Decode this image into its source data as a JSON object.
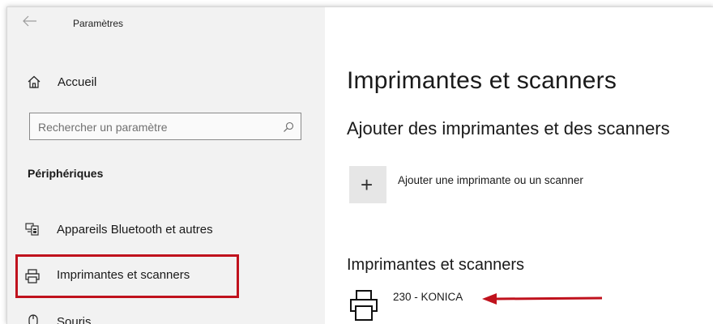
{
  "window": {
    "title": "Paramètres"
  },
  "sidebar": {
    "home_label": "Accueil",
    "search": {
      "placeholder": "Rechercher un paramètre"
    },
    "section_label": "Périphériques",
    "items": [
      {
        "label": "Appareils Bluetooth et autres",
        "icon": "bluetooth-devices-icon"
      },
      {
        "label": "Imprimantes et scanners",
        "icon": "printer-icon",
        "selected": true
      },
      {
        "label": "Souris",
        "icon": "mouse-icon"
      }
    ]
  },
  "main": {
    "page_title": "Imprimantes et scanners",
    "add_section": {
      "heading": "Ajouter des imprimantes et des scanners",
      "add_label": "Ajouter une imprimante ou un scanner",
      "add_icon": "+"
    },
    "devices_section": {
      "heading": "Imprimantes et scanners",
      "devices": [
        {
          "name": "230 - KONICA",
          "icon": "printer-icon"
        }
      ]
    }
  },
  "annotation": {
    "highlight_color": "#c0121d",
    "arrow_color": "#c0121d"
  }
}
